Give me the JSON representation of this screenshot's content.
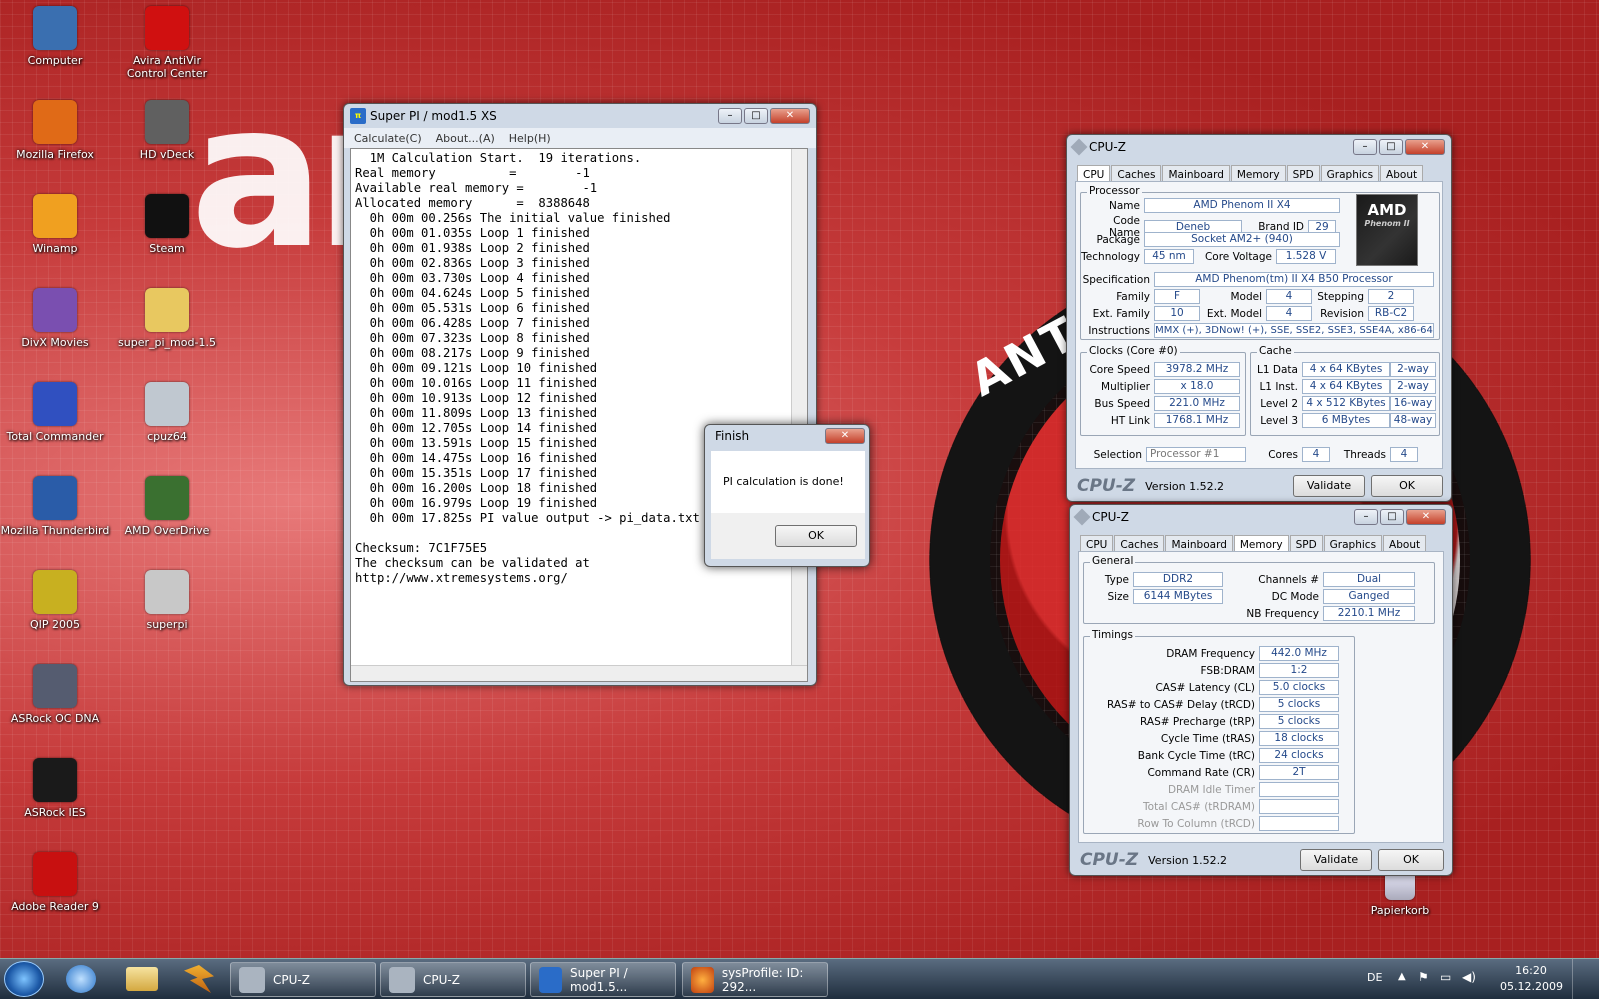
{
  "desktop": {
    "icons_col1": [
      {
        "label": "Computer",
        "name": "computer-icon",
        "color": "#3a6fb0"
      },
      {
        "label": "Mozilla Firefox",
        "name": "firefox-icon",
        "color": "#e06a17"
      },
      {
        "label": "Winamp",
        "name": "winamp-icon",
        "color": "#f0a020"
      },
      {
        "label": "DivX Movies",
        "name": "divx-icon",
        "color": "#7a4fb0"
      },
      {
        "label": "Total Commander",
        "name": "floppy-icon",
        "color": "#3050c0"
      },
      {
        "label": "Mozilla Thunderbird",
        "name": "thunderbird-icon",
        "color": "#2a5ca8"
      },
      {
        "label": "QIP 2005",
        "name": "qip-icon",
        "color": "#c8b020"
      },
      {
        "label": "ASRock OC DNA",
        "name": "asrock-ocdna-icon",
        "color": "#555c70"
      },
      {
        "label": "ASRock IES",
        "name": "asrock-ies-icon",
        "color": "#1a1a1a"
      },
      {
        "label": "Adobe Reader 9",
        "name": "adobe-reader-icon",
        "color": "#c81010"
      }
    ],
    "icons_col2": [
      {
        "label": "Avira AntiVir Control Center",
        "name": "avira-icon",
        "color": "#d01010"
      },
      {
        "label": "HD vDeck",
        "name": "hdvdeck-icon",
        "color": "#606060"
      },
      {
        "label": "Steam",
        "name": "steam-icon",
        "color": "#111111"
      },
      {
        "label": "super_pi_mod-1.5",
        "name": "folder-icon",
        "color": "#e8c860"
      },
      {
        "label": "cpuz64",
        "name": "cpuz-icon",
        "color": "#c0c8d0"
      },
      {
        "label": "AMD OverDrive",
        "name": "amd-overdrive-icon",
        "color": "#3a7030"
      },
      {
        "label": "superpi",
        "name": "superpi-icon",
        "color": "#c8c8c8"
      }
    ],
    "recycle_bin": "Papierkorb"
  },
  "superpi": {
    "title": "Super PI / mod1.5 XS",
    "menu": [
      "Calculate(C)",
      "About...(A)",
      "Help(H)"
    ],
    "console": "  1M Calculation Start.  19 iterations.\nReal memory          =        -1\nAvailable real memory =        -1\nAllocated memory      =  8388648\n  0h 00m 00.256s The initial value finished\n  0h 00m 01.035s Loop 1 finished\n  0h 00m 01.938s Loop 2 finished\n  0h 00m 02.836s Loop 3 finished\n  0h 00m 03.730s Loop 4 finished\n  0h 00m 04.624s Loop 5 finished\n  0h 00m 05.531s Loop 6 finished\n  0h 00m 06.428s Loop 7 finished\n  0h 00m 07.323s Loop 8 finished\n  0h 00m 08.217s Loop 9 finished\n  0h 00m 09.121s Loop 10 finished\n  0h 00m 10.016s Loop 11 finished\n  0h 00m 10.913s Loop 12 finished\n  0h 00m 11.809s Loop 13 finished\n  0h 00m 12.705s Loop 14 finished\n  0h 00m 13.591s Loop 15 finished\n  0h 00m 14.475s Loop 16 finished\n  0h 00m 15.351s Loop 17 finished\n  0h 00m 16.200s Loop 18 finished\n  0h 00m 16.979s Loop 19 finished\n  0h 00m 17.825s PI value output -> pi_data.txt\n\nChecksum: 7C1F75E5\nThe checksum can be validated at\nhttp://www.xtremesystems.org/"
  },
  "finish_dialog": {
    "title": "Finish",
    "message": "PI calculation is done!",
    "ok": "OK"
  },
  "cpuz1": {
    "title": "CPU-Z",
    "tabs": [
      "CPU",
      "Caches",
      "Mainboard",
      "Memory",
      "SPD",
      "Graphics",
      "About"
    ],
    "processor_label": "Processor",
    "name_label": "Name",
    "name": "AMD Phenom II X4",
    "codename_label": "Code Name",
    "codename": "Deneb",
    "brandid_label": "Brand ID",
    "brandid": "29",
    "package_label": "Package",
    "package": "Socket AM2+ (940)",
    "technology_label": "Technology",
    "technology": "45 nm",
    "corevoltage_label": "Core Voltage",
    "corevoltage": "1.528 V",
    "spec_label": "Specification",
    "spec": "AMD Phenom(tm) II X4 B50 Processor",
    "family_label": "Family",
    "family": "F",
    "model_label": "Model",
    "model": "4",
    "stepping_label": "Stepping",
    "stepping": "2",
    "extfamily_label": "Ext. Family",
    "extfamily": "10",
    "extmodel_label": "Ext. Model",
    "extmodel": "4",
    "revision_label": "Revision",
    "revision": "RB-C2",
    "instr_label": "Instructions",
    "instr": "MMX (+), 3DNow! (+), SSE, SSE2, SSE3, SSE4A, x86-64",
    "clocks_label": "Clocks (Core #0)",
    "corespeed_label": "Core Speed",
    "corespeed": "3978.2 MHz",
    "multiplier_label": "Multiplier",
    "multiplier": "x 18.0",
    "busspeed_label": "Bus Speed",
    "busspeed": "221.0 MHz",
    "htlink_label": "HT Link",
    "htlink": "1768.1 MHz",
    "cache_label": "Cache",
    "l1d_label": "L1 Data",
    "l1d": "4 x 64 KBytes",
    "l1d_way": "2-way",
    "l1i_label": "L1 Inst.",
    "l1i": "4 x 64 KBytes",
    "l1i_way": "2-way",
    "l2_label": "Level 2",
    "l2": "4 x 512 KBytes",
    "l2_way": "16-way",
    "l3_label": "Level 3",
    "l3": "6 MBytes",
    "l3_way": "48-way",
    "selection_label": "Selection",
    "selection": "Processor #1",
    "cores_label": "Cores",
    "cores": "4",
    "threads_label": "Threads",
    "threads": "4",
    "logo_text": "CPU-Z",
    "version": "Version 1.52.2",
    "validate": "Validate",
    "ok": "OK",
    "amd_logo": "AMD",
    "amd_sub": "Phenom II"
  },
  "cpuz2": {
    "title": "CPU-Z",
    "tabs": [
      "CPU",
      "Caches",
      "Mainboard",
      "Memory",
      "SPD",
      "Graphics",
      "About"
    ],
    "general_label": "General",
    "type_label": "Type",
    "type": "DDR2",
    "size_label": "Size",
    "size": "6144 MBytes",
    "channels_label": "Channels #",
    "channels": "Dual",
    "dcmode_label": "DC Mode",
    "dcmode": "Ganged",
    "nbfreq_label": "NB Frequency",
    "nbfreq": "2210.1 MHz",
    "timings_label": "Timings",
    "timings": [
      {
        "label": "DRAM Frequency",
        "value": "442.0 MHz",
        "enabled": true
      },
      {
        "label": "FSB:DRAM",
        "value": "1:2",
        "enabled": true
      },
      {
        "label": "CAS# Latency (CL)",
        "value": "5.0 clocks",
        "enabled": true
      },
      {
        "label": "RAS# to CAS# Delay (tRCD)",
        "value": "5 clocks",
        "enabled": true
      },
      {
        "label": "RAS# Precharge (tRP)",
        "value": "5 clocks",
        "enabled": true
      },
      {
        "label": "Cycle Time (tRAS)",
        "value": "18 clocks",
        "enabled": true
      },
      {
        "label": "Bank Cycle Time (tRC)",
        "value": "24 clocks",
        "enabled": true
      },
      {
        "label": "Command Rate (CR)",
        "value": "2T",
        "enabled": true
      },
      {
        "label": "DRAM Idle Timer",
        "value": "",
        "enabled": false
      },
      {
        "label": "Total CAS# (tRDRAM)",
        "value": "",
        "enabled": false
      },
      {
        "label": "Row To Column (tRCD)",
        "value": "",
        "enabled": false
      }
    ],
    "logo_text": "CPU-Z",
    "version": "Version 1.52.2",
    "validate": "Validate",
    "ok": "OK"
  },
  "taskbar": {
    "items": [
      {
        "label": "CPU-Z",
        "name": "taskbar-item-cpuz-1"
      },
      {
        "label": "CPU-Z",
        "name": "taskbar-item-cpuz-2"
      },
      {
        "label": "Super PI / mod1.5...",
        "name": "taskbar-item-superpi"
      },
      {
        "label": "sysProfile: ID: 292...",
        "name": "taskbar-item-sysprofile"
      }
    ],
    "lang": "DE",
    "time": "16:20",
    "date": "05.12.2009"
  }
}
